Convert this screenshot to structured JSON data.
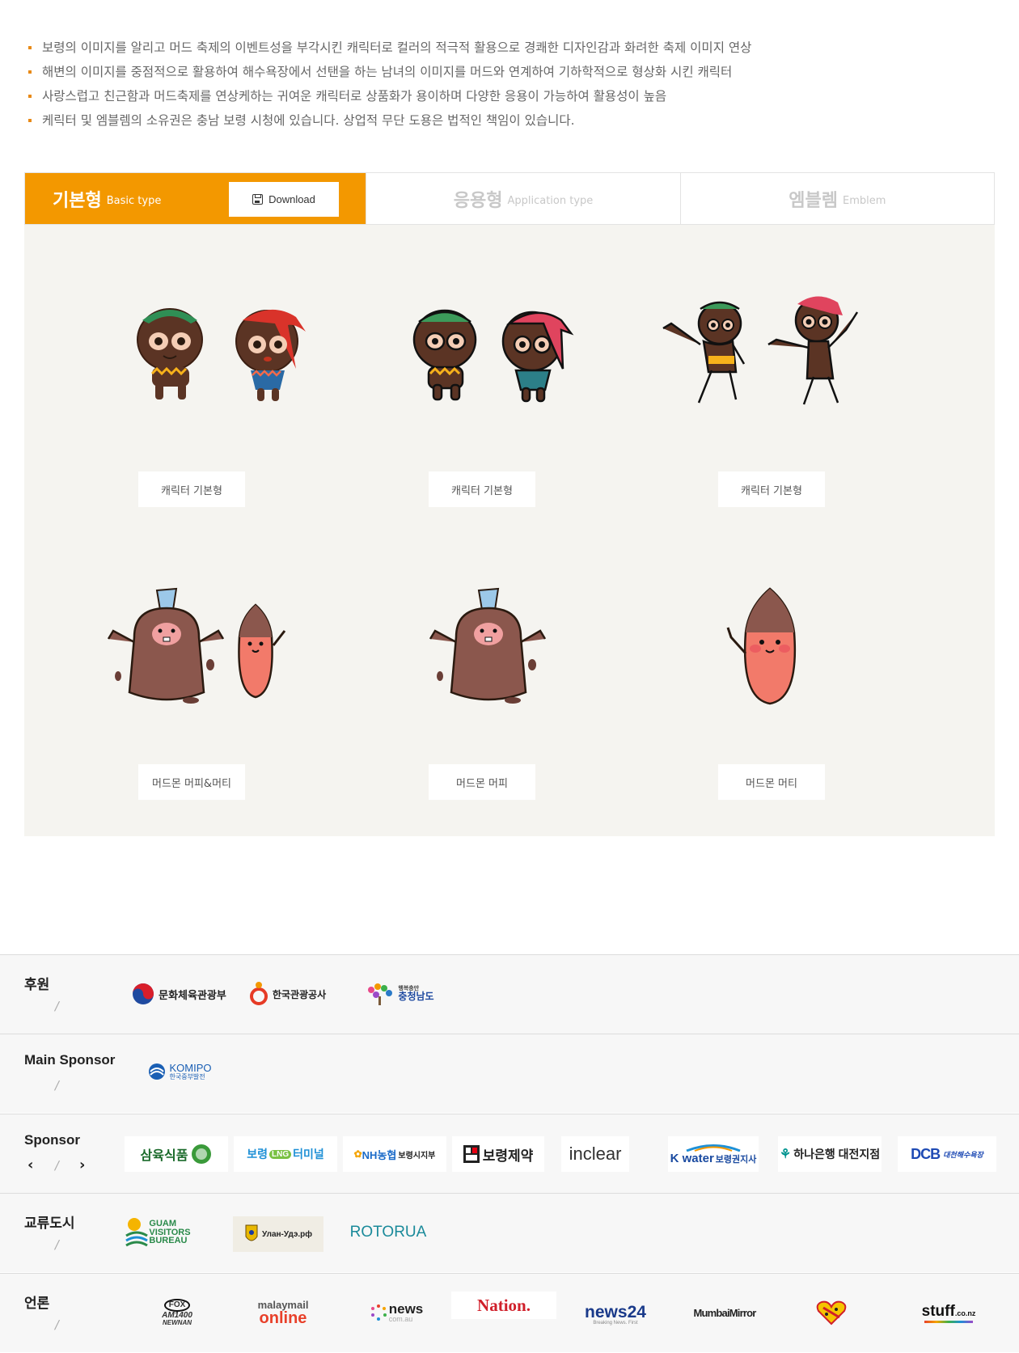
{
  "intro": {
    "bullets": [
      "보령의 이미지를 알리고 머드 축제의 이벤트성을 부각시킨 캐릭터로 컬러의 적극적 활용으로 경쾌한 디자인감과 화려한 축제 이미지 연상",
      "해변의 이미지를 중점적으로 활용하여 해수욕장에서 선탠을 하는 남녀의 이미지를 머드와 연계하여 기하학적으로 형상화 시킨 캐릭터",
      "사랑스럽고 친근함과 머드축제를 연상케하는 귀여운 캐릭터로 상품화가 용이하며 다양한 응용이 가능하여 활용성이 높음",
      "케릭터 및 엠블렘의 소유권은 충남 보령 시청에 있습니다. 상업적 무단 도용은 법적인 책임이 있습니다."
    ]
  },
  "tabs": [
    {
      "ko": "기본형",
      "en": "Basic type",
      "active": true
    },
    {
      "ko": "응용형",
      "en": "Application type",
      "active": false
    },
    {
      "ko": "엠블렘",
      "en": "Emblem",
      "active": false
    }
  ],
  "download_label": "Download",
  "gallery": {
    "captions": [
      "캐릭터 기본형",
      "캐릭터 기본형",
      "캐릭터 기본형",
      "머드몬 머피&머티",
      "머드몬 머피",
      "머드몬 머티"
    ]
  },
  "sponsors": {
    "host": {
      "title": "후원",
      "slash": "/",
      "logos": [
        "문화체육관광부",
        "한국관광공사",
        "행복충만",
        "충청남도"
      ]
    },
    "main": {
      "title": "Main Sponsor",
      "slash": "/",
      "logos": [
        "KOMIPO",
        "한국중부발전"
      ]
    },
    "sponsor": {
      "title": "Sponsor",
      "slash": "/",
      "prev": "‹",
      "next": "›",
      "logos": [
        "삼육식품",
        "보령",
        "LNG",
        "터미널",
        "NH농협",
        "보령시지부",
        "보령제약",
        "inclear",
        "K water",
        "보령권지사",
        "하나은행 대전지점",
        "DCB",
        "대천해수욕장"
      ]
    },
    "sister": {
      "title": "교류도시",
      "slash": "/",
      "logos": [
        "GUAM",
        "VISITORS",
        "BUREAU",
        "Улан-Удэ.рф",
        "ROTORUA"
      ]
    },
    "media": {
      "title": "언론",
      "slash": "/",
      "logos": [
        "FOX",
        "AM1400",
        "NEWNAN",
        "malaymail",
        "online",
        "news",
        "com.au",
        "Nation.",
        "news24",
        "Breaking News. First",
        "MumbaiMirror",
        "stuff",
        ".co.nz"
      ]
    }
  },
  "colors": {
    "accent": "#f39800",
    "gallery_bg": "#f5f4f0"
  }
}
